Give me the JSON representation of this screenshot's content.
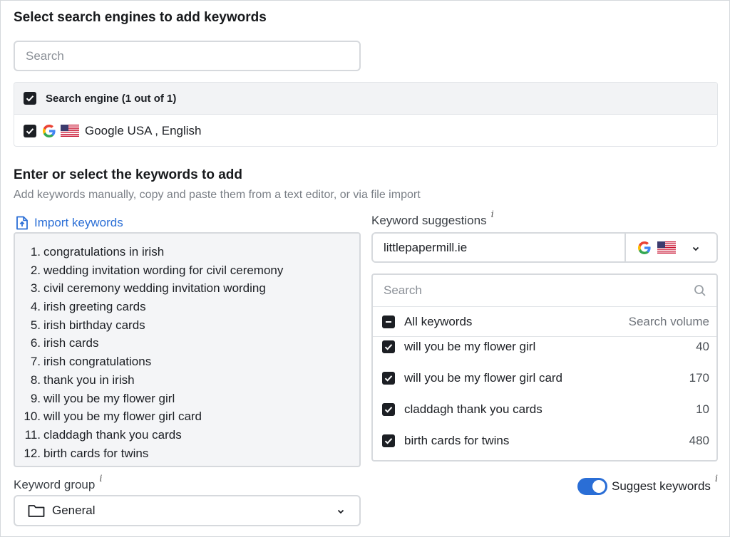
{
  "engines_section": {
    "title": "Select search engines to add keywords",
    "search_placeholder": "Search",
    "header_label": "Search engine (1 out of 1)",
    "engine": {
      "name": "Google USA , English",
      "icon": "google-icon",
      "flag": "us-flag-icon"
    }
  },
  "keywords_section": {
    "title": "Enter or select the keywords to add",
    "subtitle": "Add keywords manually, copy and paste them from a text editor, or via file import",
    "import_label": "Import keywords",
    "keywords": [
      {
        "num": "1.",
        "text": "congratulations in irish"
      },
      {
        "num": "2.",
        "text": "wedding invitation wording for civil ceremony"
      },
      {
        "num": "3.",
        "text": "civil ceremony wedding invitation wording"
      },
      {
        "num": "4.",
        "text": "irish greeting cards"
      },
      {
        "num": "5.",
        "text": "irish birthday cards"
      },
      {
        "num": "6.",
        "text": "irish cards"
      },
      {
        "num": "7.",
        "text": "irish congratulations"
      },
      {
        "num": "8.",
        "text": "thank you in irish"
      },
      {
        "num": "9.",
        "text": "will you be my flower girl"
      },
      {
        "num": "10.",
        "text": "will you be my flower girl card"
      },
      {
        "num": "11.",
        "text": "claddagh thank you cards"
      },
      {
        "num": "12.",
        "text": "birth cards for twins"
      }
    ]
  },
  "suggestions": {
    "label": "Keyword suggestions",
    "info": "i",
    "domain_value": "littlepapermill.ie",
    "search_placeholder": "Search",
    "all_label": "All keywords",
    "volume_header": "Search volume",
    "rows": [
      {
        "keyword": "will you be my flower girl",
        "volume": "40"
      },
      {
        "keyword": "will you be my flower girl card",
        "volume": "170"
      },
      {
        "keyword": "claddagh thank you cards",
        "volume": "10"
      },
      {
        "keyword": "birth cards for twins",
        "volume": "480"
      }
    ]
  },
  "group": {
    "label": "Keyword group",
    "info": "i",
    "value": "General"
  },
  "suggest_toggle": {
    "label": "Suggest keywords",
    "info": "i",
    "on": true
  },
  "colors": {
    "accent": "#2a6ed6",
    "checkbox": "#1c1f24"
  }
}
